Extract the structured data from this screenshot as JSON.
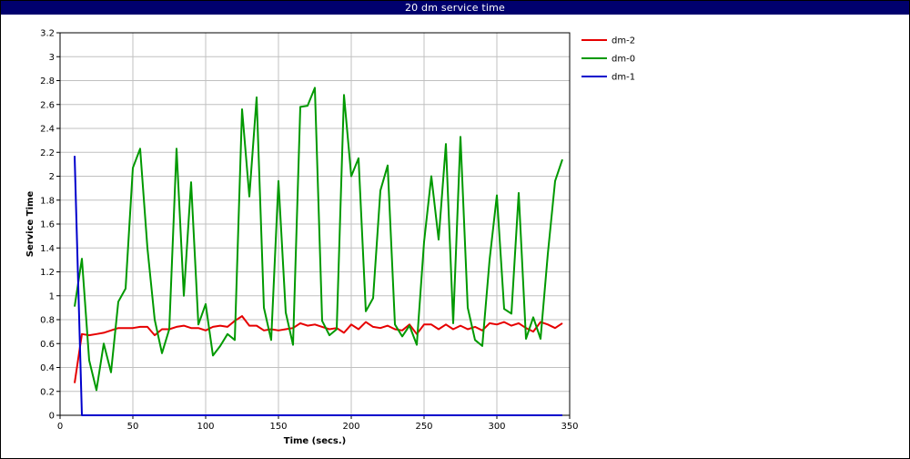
{
  "window": {
    "title": "20 dm service time"
  },
  "chart_data": {
    "type": "line",
    "title": "20 dm service time",
    "xlabel": "Time (secs.)",
    "ylabel": "Service Time",
    "xlim": [
      0,
      350
    ],
    "ylim": [
      0,
      3.2
    ],
    "x_ticks": [
      0,
      50,
      100,
      150,
      200,
      250,
      300,
      350
    ],
    "y_ticks": [
      0,
      0.2,
      0.4,
      0.6,
      0.8,
      1,
      1.2,
      1.4,
      1.6,
      1.8,
      2,
      2.2,
      2.4,
      2.6,
      2.8,
      3,
      3.2
    ],
    "grid": true,
    "legend_position": "top-right",
    "series": [
      {
        "name": "dm-2",
        "color": "#e60000",
        "points": [
          [
            10,
            0.27
          ],
          [
            15,
            0.68
          ],
          [
            20,
            0.67
          ],
          [
            25,
            0.68
          ],
          [
            30,
            0.69
          ],
          [
            35,
            0.71
          ],
          [
            40,
            0.73
          ],
          [
            45,
            0.73
          ],
          [
            50,
            0.73
          ],
          [
            55,
            0.74
          ],
          [
            60,
            0.74
          ],
          [
            65,
            0.67
          ],
          [
            70,
            0.72
          ],
          [
            75,
            0.72
          ],
          [
            80,
            0.74
          ],
          [
            85,
            0.75
          ],
          [
            90,
            0.73
          ],
          [
            95,
            0.73
          ],
          [
            100,
            0.71
          ],
          [
            105,
            0.74
          ],
          [
            110,
            0.75
          ],
          [
            115,
            0.74
          ],
          [
            120,
            0.79
          ],
          [
            125,
            0.83
          ],
          [
            130,
            0.75
          ],
          [
            135,
            0.75
          ],
          [
            140,
            0.71
          ],
          [
            145,
            0.72
          ],
          [
            150,
            0.71
          ],
          [
            155,
            0.72
          ],
          [
            160,
            0.73
          ],
          [
            165,
            0.77
          ],
          [
            170,
            0.75
          ],
          [
            175,
            0.76
          ],
          [
            180,
            0.74
          ],
          [
            185,
            0.72
          ],
          [
            190,
            0.73
          ],
          [
            195,
            0.69
          ],
          [
            200,
            0.76
          ],
          [
            205,
            0.72
          ],
          [
            210,
            0.78
          ],
          [
            215,
            0.74
          ],
          [
            220,
            0.73
          ],
          [
            225,
            0.75
          ],
          [
            230,
            0.72
          ],
          [
            235,
            0.71
          ],
          [
            240,
            0.76
          ],
          [
            245,
            0.68
          ],
          [
            250,
            0.76
          ],
          [
            255,
            0.76
          ],
          [
            260,
            0.72
          ],
          [
            265,
            0.76
          ],
          [
            270,
            0.72
          ],
          [
            275,
            0.75
          ],
          [
            280,
            0.72
          ],
          [
            285,
            0.74
          ],
          [
            290,
            0.71
          ],
          [
            295,
            0.77
          ],
          [
            300,
            0.76
          ],
          [
            305,
            0.78
          ],
          [
            310,
            0.75
          ],
          [
            315,
            0.77
          ],
          [
            320,
            0.73
          ],
          [
            325,
            0.7
          ],
          [
            330,
            0.78
          ],
          [
            335,
            0.76
          ],
          [
            340,
            0.73
          ],
          [
            345,
            0.77
          ]
        ]
      },
      {
        "name": "dm-0",
        "color": "#009900",
        "points": [
          [
            10,
            0.91
          ],
          [
            15,
            1.31
          ],
          [
            20,
            0.46
          ],
          [
            25,
            0.21
          ],
          [
            30,
            0.6
          ],
          [
            35,
            0.36
          ],
          [
            40,
            0.95
          ],
          [
            45,
            1.06
          ],
          [
            50,
            2.07
          ],
          [
            55,
            2.23
          ],
          [
            60,
            1.4
          ],
          [
            65,
            0.8
          ],
          [
            70,
            0.52
          ],
          [
            75,
            0.72
          ],
          [
            80,
            2.23
          ],
          [
            85,
            1.0
          ],
          [
            90,
            1.95
          ],
          [
            95,
            0.76
          ],
          [
            100,
            0.93
          ],
          [
            105,
            0.5
          ],
          [
            110,
            0.58
          ],
          [
            115,
            0.68
          ],
          [
            120,
            0.63
          ],
          [
            125,
            2.56
          ],
          [
            130,
            1.83
          ],
          [
            135,
            2.66
          ],
          [
            140,
            0.9
          ],
          [
            145,
            0.63
          ],
          [
            150,
            1.96
          ],
          [
            155,
            0.86
          ],
          [
            160,
            0.59
          ],
          [
            165,
            2.58
          ],
          [
            170,
            2.59
          ],
          [
            175,
            2.74
          ],
          [
            180,
            0.79
          ],
          [
            185,
            0.67
          ],
          [
            190,
            0.72
          ],
          [
            195,
            2.68
          ],
          [
            200,
            2.0
          ],
          [
            205,
            2.15
          ],
          [
            210,
            0.87
          ],
          [
            215,
            0.98
          ],
          [
            220,
            1.88
          ],
          [
            225,
            2.09
          ],
          [
            230,
            0.76
          ],
          [
            235,
            0.66
          ],
          [
            240,
            0.75
          ],
          [
            245,
            0.59
          ],
          [
            250,
            1.45
          ],
          [
            255,
            2.0
          ],
          [
            260,
            1.47
          ],
          [
            265,
            2.27
          ],
          [
            270,
            0.77
          ],
          [
            275,
            2.33
          ],
          [
            280,
            0.9
          ],
          [
            285,
            0.63
          ],
          [
            290,
            0.58
          ],
          [
            295,
            1.3
          ],
          [
            300,
            1.84
          ],
          [
            305,
            0.89
          ],
          [
            310,
            0.85
          ],
          [
            315,
            1.86
          ],
          [
            320,
            0.64
          ],
          [
            325,
            0.82
          ],
          [
            330,
            0.64
          ],
          [
            335,
            1.35
          ],
          [
            340,
            1.96
          ],
          [
            345,
            2.14
          ]
        ]
      },
      {
        "name": "dm-1",
        "color": "#0000cc",
        "points": [
          [
            10,
            2.17
          ],
          [
            15,
            0
          ],
          [
            20,
            0
          ],
          [
            345,
            0
          ]
        ]
      }
    ]
  }
}
